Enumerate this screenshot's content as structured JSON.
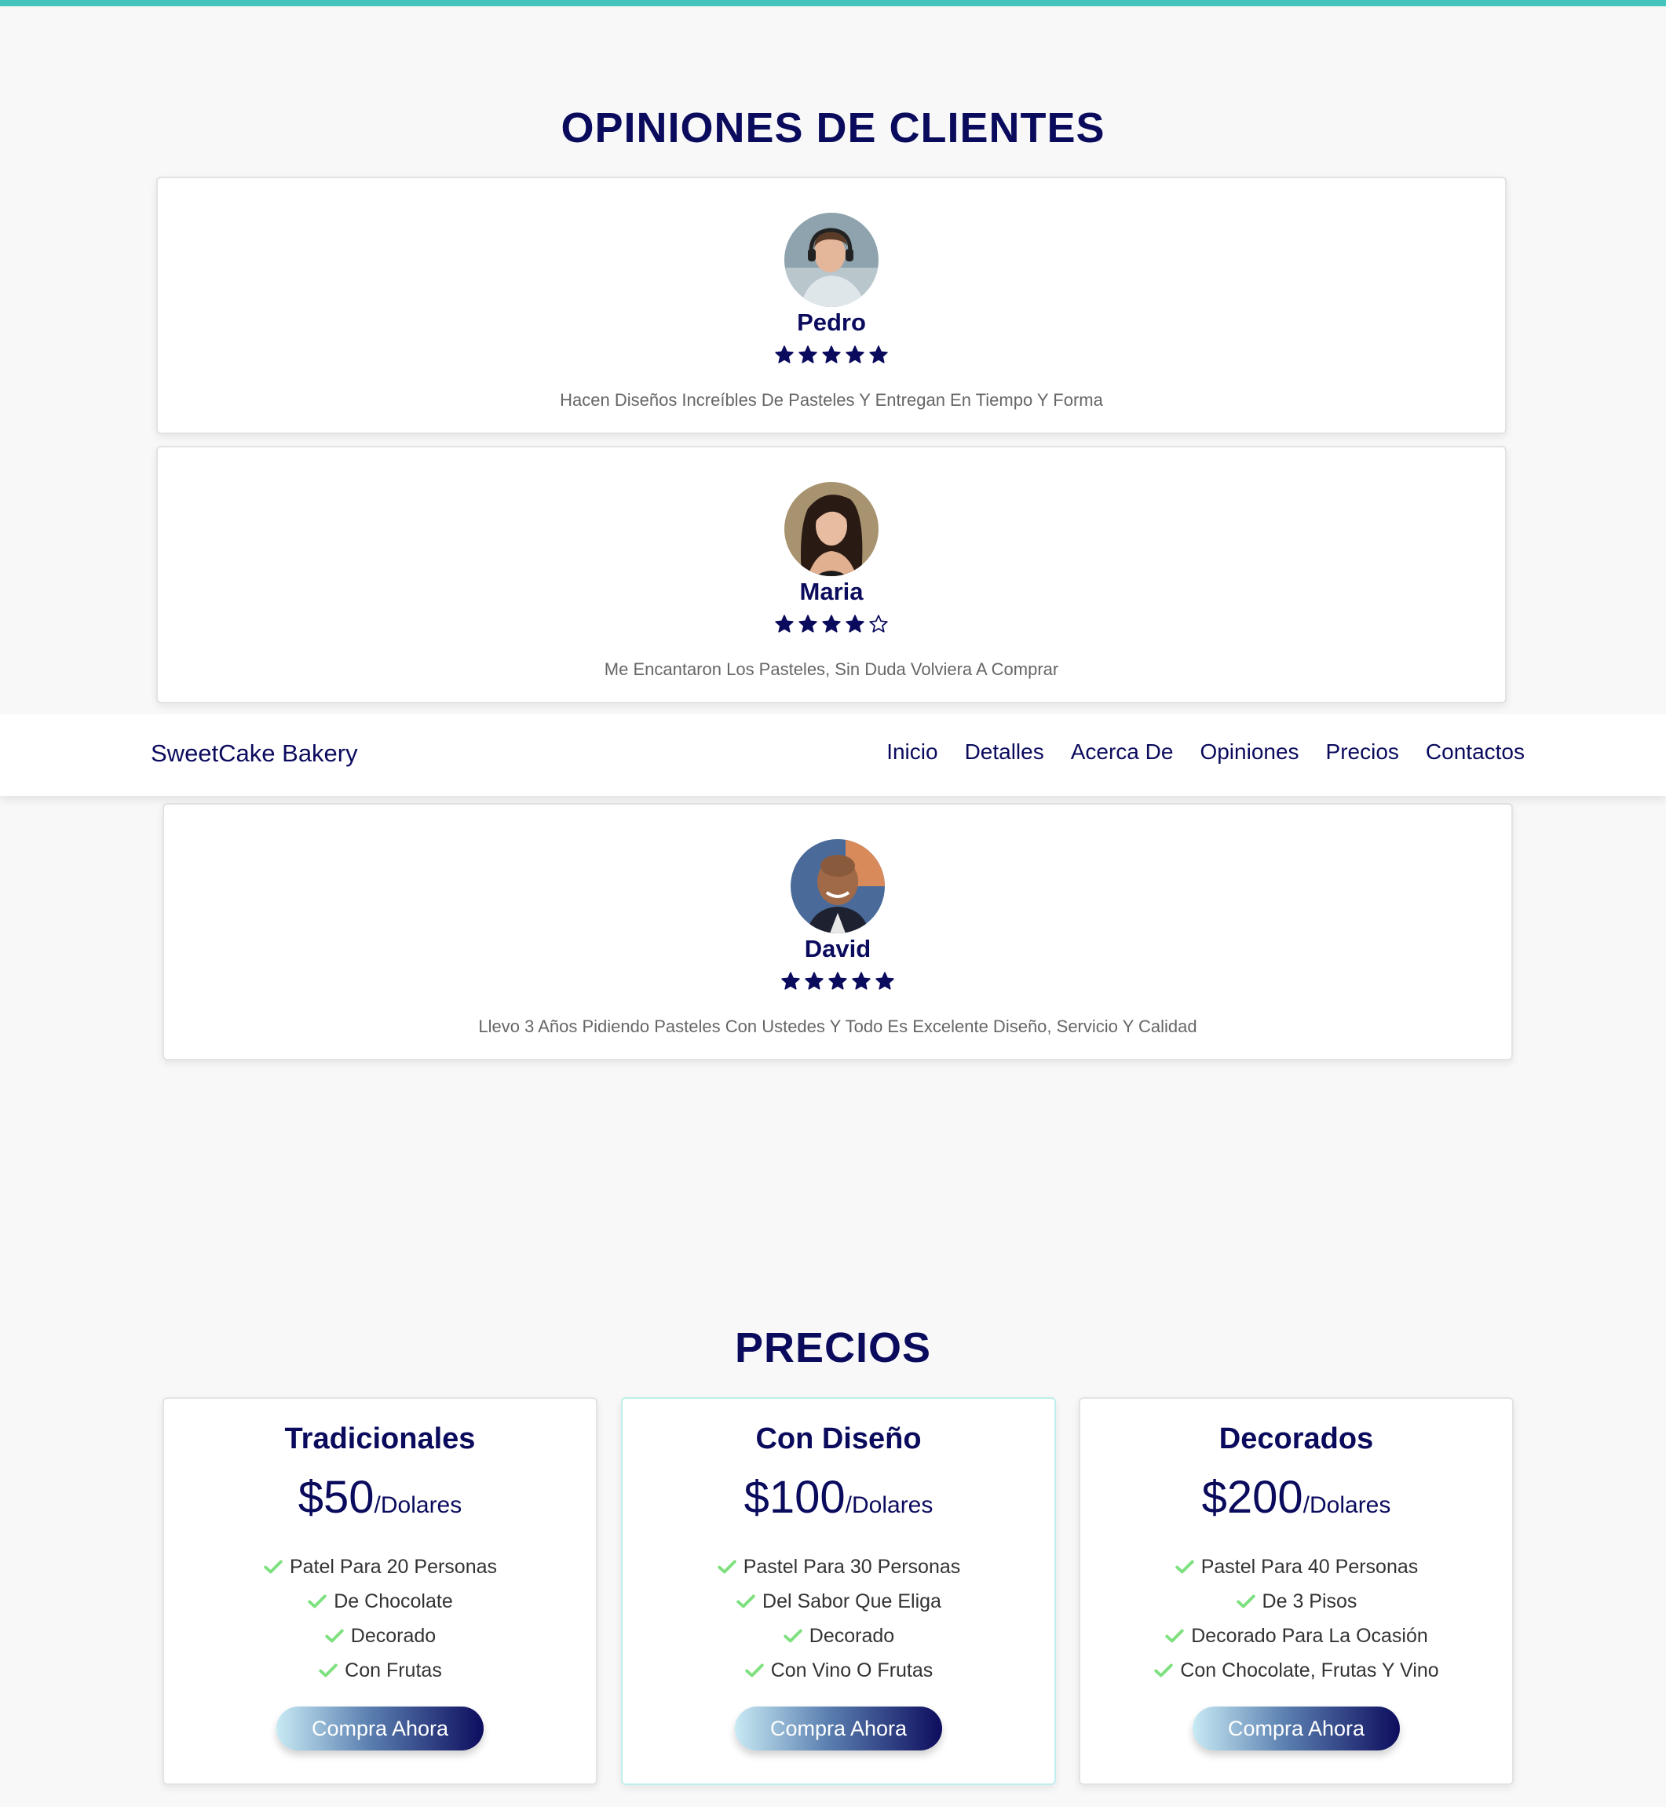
{
  "reviews": {
    "title": "OPINIONES DE CLIENTES",
    "items": [
      {
        "name": "Pedro",
        "rating": 5,
        "text": "Hacen Diseños Increíbles De Pasteles Y Entregan En Tiempo Y Forma"
      },
      {
        "name": "Maria",
        "rating": 4,
        "text": "Me Encantaron Los Pasteles, Sin Duda Volviera A Comprar"
      },
      {
        "name": "David",
        "rating": 5,
        "text": "Llevo 3 Años Pidiendo Pasteles Con Ustedes Y Todo Es Excelente Diseño, Servicio Y Calidad"
      }
    ]
  },
  "navbar": {
    "brand": "SweetCake Bakery",
    "links": [
      "Inicio",
      "Detalles",
      "Acerca De",
      "Opiniones",
      "Precios",
      "Contactos"
    ]
  },
  "pricing": {
    "title": "PRECIOS",
    "plans": [
      {
        "name": "Tradicionales",
        "price": "$50",
        "unit": "/Dolares",
        "features": [
          "Patel Para 20 Personas",
          "De Chocolate",
          "Decorado",
          "Con Frutas"
        ],
        "button": "Compra Ahora"
      },
      {
        "name": "Con Diseño",
        "price": "$100",
        "unit": "/Dolares",
        "features": [
          "Pastel Para 30 Personas",
          "Del Sabor Que Eliga",
          "Decorado",
          "Con Vino O Frutas"
        ],
        "button": "Compra Ahora"
      },
      {
        "name": "Decorados",
        "price": "$200",
        "unit": "/Dolares",
        "features": [
          "Pastel Para 40 Personas",
          "De 3 Pisos",
          "Decorado Para La Ocasión",
          "Con Chocolate, Frutas Y Vino"
        ],
        "button": "Compra Ahora"
      }
    ]
  },
  "colors": {
    "accent": "#45c4bd",
    "primary": "#0b0b5e",
    "check": "#7ee07e"
  },
  "icons": {
    "star_filled": "star-icon",
    "star_empty": "star-outline-icon",
    "check": "check-icon"
  }
}
